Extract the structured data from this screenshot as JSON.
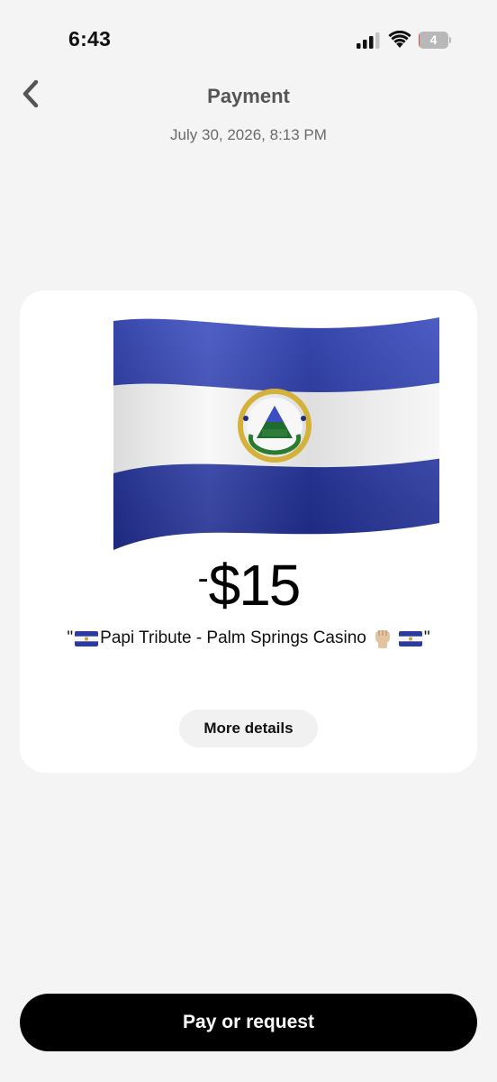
{
  "status_bar": {
    "time": "6:43",
    "battery_level": "4",
    "battery_percent": 4,
    "icons": [
      "signal-icon",
      "wifi-icon",
      "battery-icon"
    ]
  },
  "header": {
    "back_icon": "chevron-left-icon",
    "title": "Payment",
    "date": "July 30, 2026, 8:13 PM"
  },
  "transaction": {
    "image": "el-salvador-flag",
    "amount_sign": "-",
    "amount": "$15",
    "note_open_quote": "\"",
    "note_text": "Papi Tribute - Palm Springs Casino",
    "note_close_quote": "\"",
    "note_emojis": [
      "el-salvador-flag-emoji",
      "raised-fist-emoji",
      "el-salvador-flag-emoji"
    ],
    "details_label": "More details"
  },
  "actions": {
    "pay_label": "Pay or request"
  },
  "colors": {
    "background": "#f4f4f4",
    "card": "#ffffff",
    "primary_button": "#000000",
    "flag_blue": "#2b3aa0",
    "battery_low": "#ff453a"
  }
}
